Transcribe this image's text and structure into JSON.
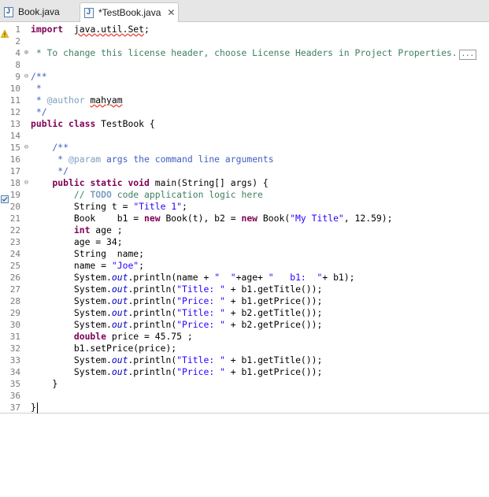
{
  "tabs": [
    {
      "label": "Book.java",
      "active": false
    },
    {
      "label": "*TestBook.java",
      "active": true
    }
  ],
  "icons": {
    "file": "java-file-icon",
    "close": "close-icon",
    "warning": "warning-icon",
    "task": "task-icon",
    "fold": "fold-icon"
  },
  "colors": {
    "keyword": "#7f0055",
    "comment": "#3f7f5f",
    "javadoc": "#3f5fbf",
    "string": "#2a00ff",
    "field": "#0000c0",
    "line_number": "#7a7a7a"
  },
  "editor": {
    "lines": [
      {
        "n": "1",
        "fold": "",
        "parts": [
          [
            "kw",
            "import"
          ],
          [
            "",
            "  "
          ],
          [
            "sq",
            "java.util.Set"
          ],
          [
            "",
            ";"
          ]
        ],
        "mark": "warning"
      },
      {
        "n": "2",
        "fold": "",
        "parts": []
      },
      {
        "n": "4",
        "fold": "+",
        "parts": [
          [
            "cm",
            " * To change this license header, choose License Headers in Project Properties."
          ]
        ],
        "collapsed": "..."
      },
      {
        "n": "8",
        "fold": "",
        "parts": []
      },
      {
        "n": "9",
        "fold": "-",
        "parts": [
          [
            "jd",
            "/**"
          ]
        ]
      },
      {
        "n": "10",
        "fold": "",
        "parts": [
          [
            "jd",
            " *"
          ]
        ]
      },
      {
        "n": "11",
        "fold": "",
        "parts": [
          [
            "jd",
            " * "
          ],
          [
            "jt",
            "@author"
          ],
          [
            "jd",
            " "
          ],
          [
            "sq",
            "mahyam"
          ]
        ]
      },
      {
        "n": "12",
        "fold": "",
        "parts": [
          [
            "jd",
            " */"
          ]
        ]
      },
      {
        "n": "13",
        "fold": "",
        "parts": [
          [
            "kw",
            "public"
          ],
          [
            "",
            " "
          ],
          [
            "kw",
            "class"
          ],
          [
            "",
            " TestBook {"
          ]
        ]
      },
      {
        "n": "14",
        "fold": "",
        "parts": []
      },
      {
        "n": "15",
        "fold": "-",
        "parts": [
          [
            "jd",
            "    /**"
          ]
        ]
      },
      {
        "n": "16",
        "fold": "",
        "parts": [
          [
            "jd",
            "     * "
          ],
          [
            "jt",
            "@param"
          ],
          [
            "jd",
            " args the command line arguments"
          ]
        ]
      },
      {
        "n": "17",
        "fold": "",
        "parts": [
          [
            "jd",
            "     */"
          ]
        ]
      },
      {
        "n": "18",
        "fold": "-",
        "parts": [
          [
            "kw",
            "    public"
          ],
          [
            "",
            " "
          ],
          [
            "kw",
            "static"
          ],
          [
            "",
            " "
          ],
          [
            "kw",
            "void"
          ],
          [
            "",
            " main(String[] args) {"
          ]
        ]
      },
      {
        "n": "19",
        "fold": "",
        "parts": [
          [
            "cm",
            "        // "
          ],
          [
            "todo",
            "TODO"
          ],
          [
            "cm",
            " code application logic here"
          ]
        ],
        "mark": "task"
      },
      {
        "n": "20",
        "fold": "",
        "parts": [
          [
            "",
            "        String t = "
          ],
          [
            "st",
            "\"Title 1\""
          ],
          [
            "",
            ";"
          ]
        ]
      },
      {
        "n": "21",
        "fold": "",
        "parts": [
          [
            "",
            "        Book    b1 = "
          ],
          [
            "kw",
            "new"
          ],
          [
            "",
            " Book(t), b2 = "
          ],
          [
            "kw",
            "new"
          ],
          [
            "",
            " Book("
          ],
          [
            "st",
            "\"My Title\""
          ],
          [
            "",
            ", 12.59);"
          ]
        ]
      },
      {
        "n": "22",
        "fold": "",
        "parts": [
          [
            "kw",
            "        int"
          ],
          [
            "",
            " age ;"
          ]
        ]
      },
      {
        "n": "23",
        "fold": "",
        "parts": [
          [
            "",
            "        age = 34;"
          ]
        ]
      },
      {
        "n": "24",
        "fold": "",
        "parts": [
          [
            "",
            "        String  name;"
          ]
        ]
      },
      {
        "n": "25",
        "fold": "",
        "parts": [
          [
            "",
            "        name = "
          ],
          [
            "st",
            "\"Joe\""
          ],
          [
            "",
            ";"
          ]
        ]
      },
      {
        "n": "26",
        "fold": "",
        "parts": [
          [
            "",
            "        System."
          ],
          [
            "fi",
            "out"
          ],
          [
            "",
            ".println(name + "
          ],
          [
            "st",
            "\"  \""
          ],
          [
            "",
            "+age+ "
          ],
          [
            "st",
            "\"   b1:  \""
          ],
          [
            "",
            "+ b1);"
          ]
        ]
      },
      {
        "n": "27",
        "fold": "",
        "parts": [
          [
            "",
            "        System."
          ],
          [
            "fi",
            "out"
          ],
          [
            "",
            ".println("
          ],
          [
            "st",
            "\"Title: \""
          ],
          [
            "",
            " + b1.getTitle());"
          ]
        ]
      },
      {
        "n": "28",
        "fold": "",
        "parts": [
          [
            "",
            "        System."
          ],
          [
            "fi",
            "out"
          ],
          [
            "",
            ".println("
          ],
          [
            "st",
            "\"Price: \""
          ],
          [
            "",
            " + b1.getPrice());"
          ]
        ]
      },
      {
        "n": "29",
        "fold": "",
        "parts": [
          [
            "",
            "        System."
          ],
          [
            "fi",
            "out"
          ],
          [
            "",
            ".println("
          ],
          [
            "st",
            "\"Title: \""
          ],
          [
            "",
            " + b2.getTitle());"
          ]
        ]
      },
      {
        "n": "30",
        "fold": "",
        "parts": [
          [
            "",
            "        System."
          ],
          [
            "fi",
            "out"
          ],
          [
            "",
            ".println("
          ],
          [
            "st",
            "\"Price: \""
          ],
          [
            "",
            " + b2.getPrice());"
          ]
        ]
      },
      {
        "n": "31",
        "fold": "",
        "parts": [
          [
            "kw",
            "        double"
          ],
          [
            "",
            " price = 45.75 ;"
          ]
        ]
      },
      {
        "n": "32",
        "fold": "",
        "parts": [
          [
            "",
            "        b1.setPrice(price);"
          ]
        ]
      },
      {
        "n": "33",
        "fold": "",
        "parts": [
          [
            "",
            "        System."
          ],
          [
            "fi",
            "out"
          ],
          [
            "",
            ".println("
          ],
          [
            "st",
            "\"Title: \""
          ],
          [
            "",
            " + b1.getTitle());"
          ]
        ]
      },
      {
        "n": "34",
        "fold": "",
        "parts": [
          [
            "",
            "        System."
          ],
          [
            "fi",
            "out"
          ],
          [
            "",
            ".println("
          ],
          [
            "st",
            "\"Price: \""
          ],
          [
            "",
            " + b1.getPrice());"
          ]
        ]
      },
      {
        "n": "35",
        "fold": "",
        "parts": [
          [
            "",
            "    }"
          ]
        ]
      },
      {
        "n": "36",
        "fold": "",
        "parts": []
      },
      {
        "n": "37",
        "fold": "",
        "parts": [
          [
            "",
            "}"
          ]
        ],
        "caret": true
      }
    ]
  }
}
